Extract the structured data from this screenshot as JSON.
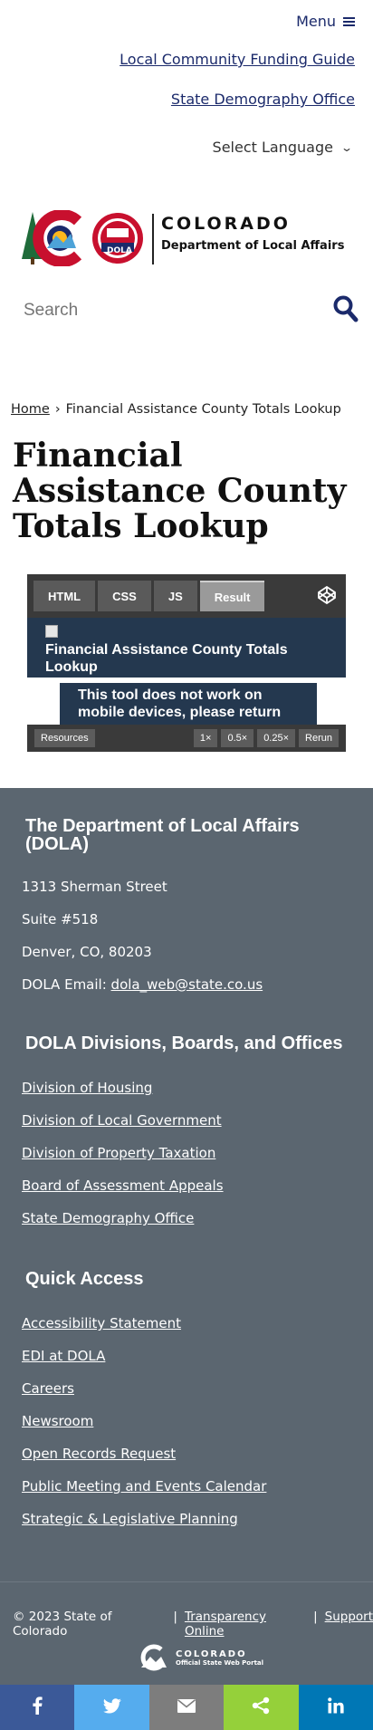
{
  "header": {
    "menu_label": "Menu",
    "links": [
      "Local Community Funding Guide",
      "State Demography Office"
    ],
    "language_label": "Select Language"
  },
  "logo": {
    "title": "COLORADO",
    "subtitle": "Department of Local Affairs",
    "badge_text": "DOLA"
  },
  "search": {
    "placeholder": "Search"
  },
  "breadcrumb": {
    "home": "Home",
    "separator": "›",
    "current": "Financial Assistance County Totals Lookup"
  },
  "page": {
    "title": "Financial Assistance County Totals Lookup"
  },
  "embed": {
    "tabs": [
      "HTML",
      "CSS",
      "JS",
      "Result"
    ],
    "active_tab": "Result",
    "result_title": "Financial Assistance County Totals Lookup",
    "result_note": "This tool does not work on mobile devices, please return",
    "footer_buttons": [
      "Resources",
      "1×",
      "0.5×",
      "0.25×",
      "Rerun"
    ]
  },
  "footer": {
    "dept_heading": "The Department of Local Affairs (DOLA)",
    "address": [
      "1313 Sherman Street",
      "Suite  #518",
      "Denver, CO, 80203"
    ],
    "email_label": "DOLA Email:",
    "email": "dola_web@state.co.us",
    "divisions_heading": "DOLA Divisions, Boards, and Offices",
    "divisions": [
      "Division of Housing",
      "Division of Local Government",
      "Division of Property Taxation",
      "Board of Assessment Appeals",
      "State Demography Office"
    ],
    "quick_heading": "Quick Access",
    "quick_links": [
      "Accessibility Statement",
      "EDI at DOLA",
      "Careers",
      "Newsroom",
      "Open Records Request",
      "Public Meeting and Events Calendar",
      "Strategic & Legislative Planning"
    ]
  },
  "legal": {
    "copyright": "© 2023 State of Colorado",
    "separator": "|",
    "links": [
      "Transparency Online",
      "Support"
    ],
    "portal_title": "COLORADO",
    "portal_sub": "Official State Web Portal"
  },
  "share": {
    "buttons": [
      {
        "icon": "facebook-icon",
        "color": "#3b5998"
      },
      {
        "icon": "twitter-icon",
        "color": "#55acee"
      },
      {
        "icon": "email-icon",
        "color": "#7d7d7d"
      },
      {
        "icon": "share-icon",
        "color": "#95d03a"
      },
      {
        "icon": "linkedin-icon",
        "color": "#0077b5"
      }
    ]
  },
  "colors": {
    "brand_navy": "#1b2a6b",
    "footer_bg": "#5b6670",
    "embed_result_bg": "#24384f"
  }
}
